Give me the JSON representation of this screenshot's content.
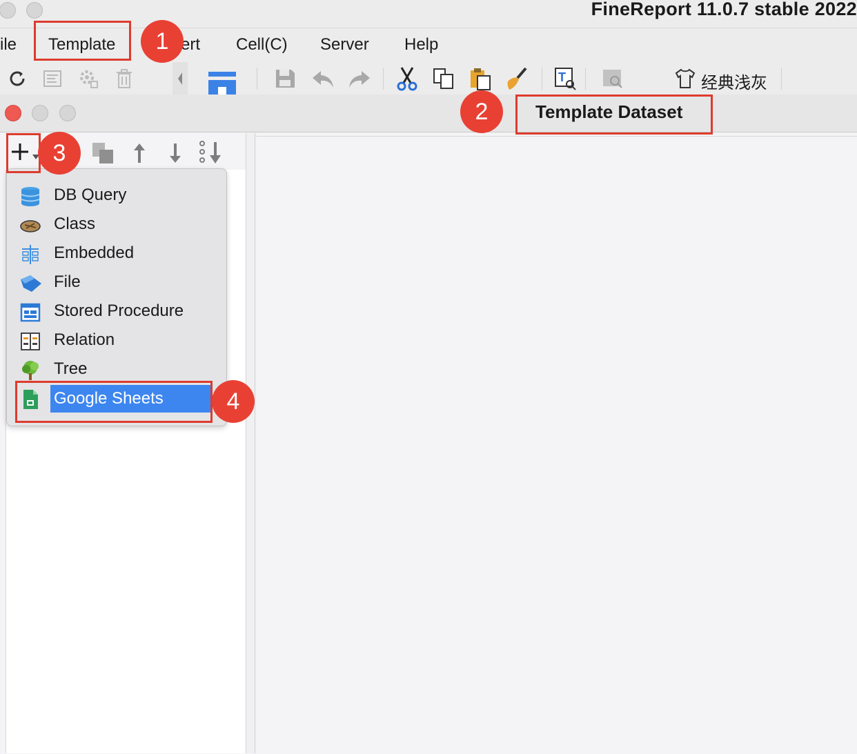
{
  "app": {
    "title": "FineReport 11.0.7 stable 2022"
  },
  "menubar": {
    "items": [
      {
        "label": "ile"
      },
      {
        "label": "Template"
      },
      {
        "label": "ert"
      },
      {
        "label": "Cell(C)"
      },
      {
        "label": "Server"
      },
      {
        "label": "Help"
      }
    ]
  },
  "toolbar": {
    "theme_label": "经典浅灰"
  },
  "dialog": {
    "title": "Template Dataset"
  },
  "dataset_menu": {
    "items": [
      {
        "label": "DB Query",
        "icon": "db-query-icon"
      },
      {
        "label": "Class",
        "icon": "class-icon"
      },
      {
        "label": "Embedded",
        "icon": "embedded-icon"
      },
      {
        "label": "File",
        "icon": "file-icon"
      },
      {
        "label": "Stored Procedure",
        "icon": "stored-procedure-icon"
      },
      {
        "label": "Relation",
        "icon": "relation-icon"
      },
      {
        "label": "Tree",
        "icon": "tree-icon"
      },
      {
        "label": "Google Sheets",
        "icon": "google-sheets-icon",
        "selected": true
      }
    ]
  },
  "annotations": {
    "step1": "1",
    "step2": "2",
    "step3": "3",
    "step4": "4"
  },
  "colors": {
    "highlight": "#dd3b2e",
    "selection": "#3d86f0"
  }
}
